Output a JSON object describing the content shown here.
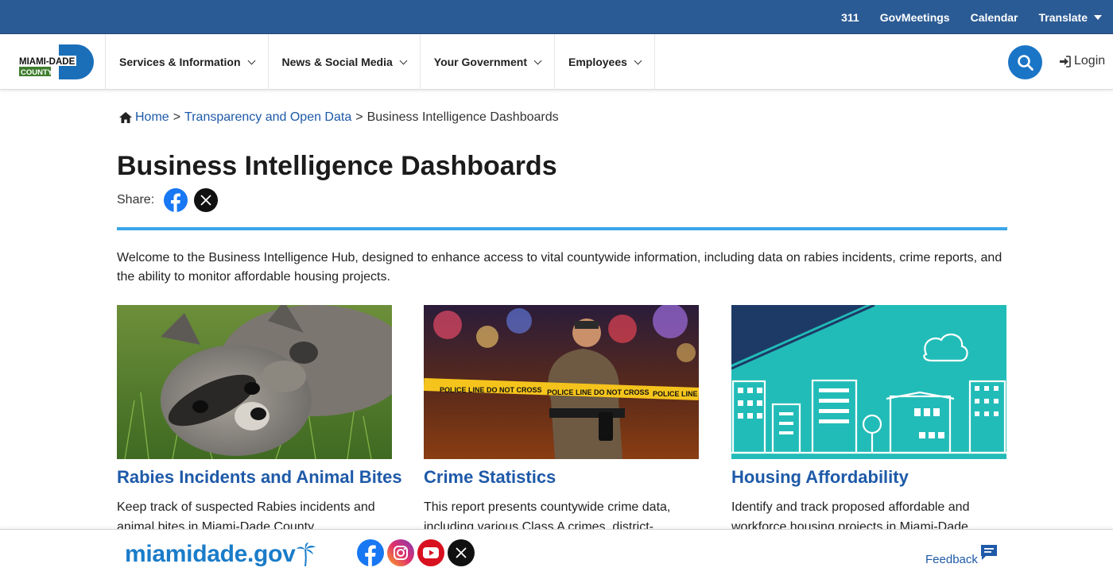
{
  "topbar": {
    "links": [
      "311",
      "GovMeetings",
      "Calendar"
    ],
    "translate_label": "Translate"
  },
  "logo": {
    "line1": "MIAMI-DADE",
    "line2": "COUNTY"
  },
  "nav": {
    "items": [
      "Services & Information",
      "News & Social Media",
      "Your Government",
      "Employees"
    ],
    "login_label": "Login",
    "search_icon": "search-icon"
  },
  "breadcrumb": {
    "home": "Home",
    "sep": ">",
    "parent": "Transparency and Open Data",
    "current": "Business Intelligence Dashboards"
  },
  "page": {
    "title": "Business Intelligence Dashboards",
    "share_label": "Share:",
    "intro": "Welcome to the Business Intelligence Hub, designed to enhance access to vital countywide information, including data on rabies incidents, crime reports, and the ability to monitor affordable housing projects."
  },
  "cards": [
    {
      "title": "Rabies Incidents and Animal Bites",
      "text": "Keep track of suspected Rabies incidents and animal bites in Miami-Dade County."
    },
    {
      "title": "Crime Statistics",
      "text": "This report presents countywide crime data, including various Class A crimes, district-",
      "tape_text": "POLICE LINE DO NOT CROSS"
    },
    {
      "title": "Housing Affordability",
      "text": "Identify and track proposed affordable and workforce housing projects in Miami-Dade"
    }
  ],
  "footer": {
    "brand": "miamidade.gov",
    "feedback_label": "Feedback"
  },
  "colors": {
    "topbar": "#2b5b94",
    "link": "#1e5aa8",
    "accent_rule": "#3ba5e8",
    "search_button": "#1a75c6",
    "housing_teal": "#22bcb8"
  }
}
